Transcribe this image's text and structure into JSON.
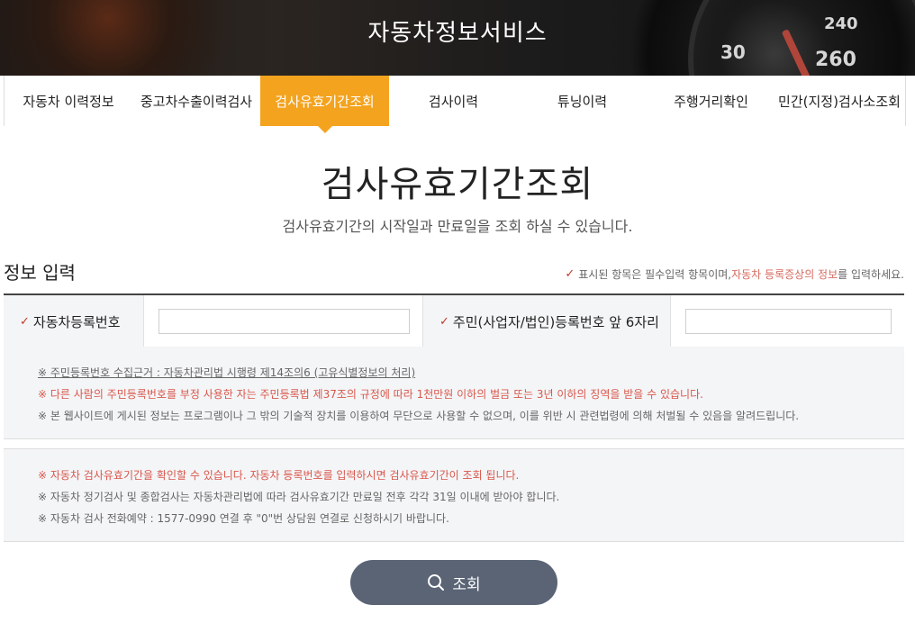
{
  "header": {
    "title": "자동차정보서비스",
    "gauge_numbers": [
      "30",
      "240",
      "260"
    ]
  },
  "nav": {
    "tabs": [
      {
        "label": "자동차 이력정보",
        "active": false
      },
      {
        "label": "중고차수출이력검사",
        "active": false
      },
      {
        "label": "검사유효기간조회",
        "active": true
      },
      {
        "label": "검사이력",
        "active": false
      },
      {
        "label": "튜닝이력",
        "active": false
      },
      {
        "label": "주행거리확인",
        "active": false
      },
      {
        "label": "민간(지정)검사소조회",
        "active": false
      }
    ]
  },
  "main": {
    "title": "검사유효기간조회",
    "subtitle": "검사유효기간의 시작일과 만료일을 조회 하실 수 있습니다."
  },
  "form": {
    "section_title": "정보 입력",
    "required_note": {
      "prefix": "표시된 항목은 필수입력 항목이며,",
      "highlight": " 자동차 등록증상의 정보",
      "suffix": "를 입력하세요."
    },
    "vehicle_number_label": "자동차등록번호",
    "vehicle_number_value": "",
    "resident_number_label": "주민(사업자/법인)등록번호 앞 6자리",
    "resident_number_value": ""
  },
  "notice1": [
    "※ 주민등록번호 수집근거 : 자동차관리법 시행령 제14조의6 (고유식별정보의 처리)",
    "※ 다른 사람의 주민등록번호를 부정 사용한 자는 주민등록법 제37조의 규정에 따라 1천만원 이하의 벌금 또는 3년 이하의 징역을 받을 수 있습니다.",
    "※ 본 웹사이트에 게시된 정보는 프로그램이나 그 밖의 기술적 장치를 이용하여 무단으로 사용할 수 없으며, 이를 위반 시 관련법령에 의해 처벌될 수 있음을 알려드립니다."
  ],
  "notice2": [
    "※ 자동차 검사유효기간을 확인할 수 있습니다. 자동차 등록번호를 입력하시면 검사유효기간이 조회 됩니다.",
    "※ 자동차 정기검사 및 종합검사는 자동차관리법에 따라 검사유효기간 만료일 전후 각각 31일 이내에 받아야 합니다.",
    "※ 자동차 검사 전화예약 : 1577-0990 연결 후 \"0\"번 상담원 연결로 신청하시기 바랍니다."
  ],
  "search_button": {
    "label": "조회",
    "icon": "search-icon"
  },
  "colors": {
    "accent": "#f4a31f",
    "button": "#5a6475",
    "warning": "#d9574b"
  }
}
